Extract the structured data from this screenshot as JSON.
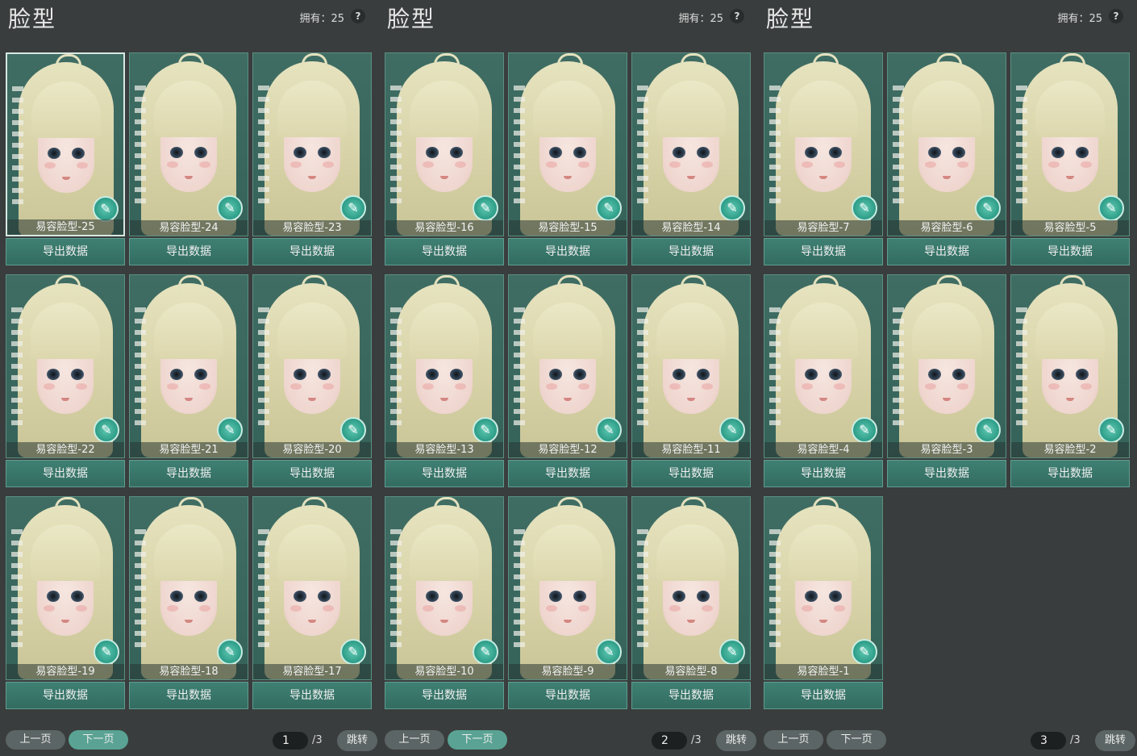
{
  "panels": [
    {
      "title": "脸型",
      "owned": "拥有：25",
      "help": "?",
      "cards": [
        "易容脸型-25",
        "易容脸型-24",
        "易容脸型-23",
        "易容脸型-22",
        "易容脸型-21",
        "易容脸型-20",
        "易容脸型-19",
        "易容脸型-18",
        "易容脸型-17"
      ],
      "export_label": "导出数据",
      "prev_label": "上一页",
      "next_label": "下一页",
      "page_value": "1",
      "page_total": "/3",
      "jump_label": "跳转"
    },
    {
      "title": "脸型",
      "owned": "拥有：25",
      "help": "?",
      "cards": [
        "易容脸型-16",
        "易容脸型-15",
        "易容脸型-14",
        "易容脸型-13",
        "易容脸型-12",
        "易容脸型-11",
        "易容脸型-10",
        "易容脸型-9",
        "易容脸型-8"
      ],
      "export_label": "导出数据",
      "prev_label": "上一页",
      "next_label": "下一页",
      "page_value": "2",
      "page_total": "/3",
      "jump_label": "跳转"
    },
    {
      "title": "脸型",
      "owned": "拥有：25",
      "help": "?",
      "cards": [
        "易容脸型-7",
        "易容脸型-6",
        "易容脸型-5",
        "易容脸型-4",
        "易容脸型-3",
        "易容脸型-2",
        "易容脸型-1"
      ],
      "export_label": "导出数据",
      "prev_label": "上一页",
      "next_label": "下一页",
      "page_value": "3",
      "page_total": "/3",
      "jump_label": "跳转"
    }
  ],
  "icon_names": {
    "card_badge": "brush-icon",
    "help": "question-icon"
  },
  "colors": {
    "accent": "#5aa394",
    "card_bg": "#2e5b52",
    "button": "#3f8073",
    "background": "#3a3d3d"
  },
  "selected_card": "易容脸型-25"
}
